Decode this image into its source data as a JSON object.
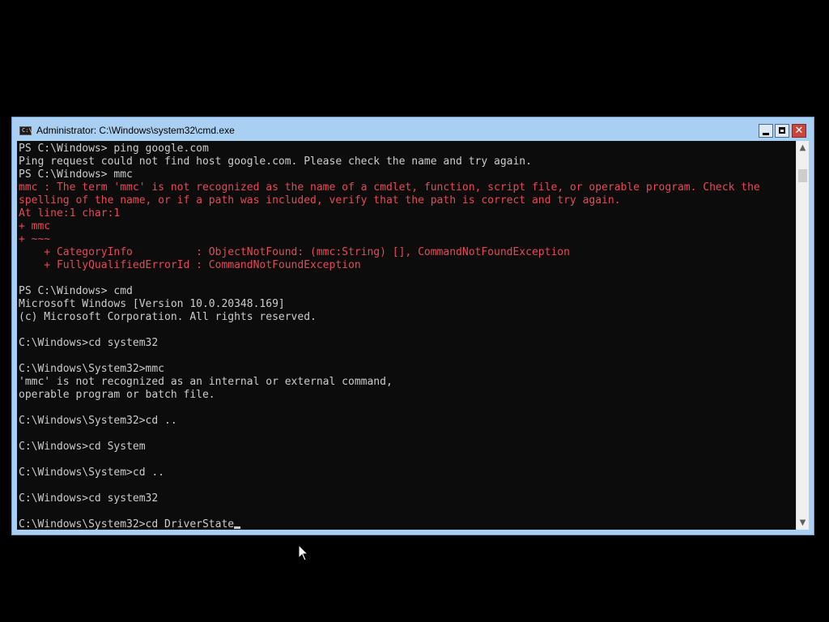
{
  "window": {
    "title": "Administrator: C:\\Windows\\system32\\cmd.exe",
    "icon": "cmd-icon",
    "icon_text": "C:\\",
    "controls": {
      "minimize": "minimize-icon",
      "maximize": "maximize-icon",
      "close": "close-icon",
      "close_glyph": "✕"
    }
  },
  "colors": {
    "console_bg": "#0c0c0c",
    "text": "#cccccc",
    "error_text": "#e74856",
    "titlebar": "#a9d0f2",
    "close_button": "#c8473c"
  },
  "console": {
    "lines": [
      {
        "text": "PS C:\\Windows> ping google.com",
        "style": "normal"
      },
      {
        "text": "Ping request could not find host google.com. Please check the name and try again.",
        "style": "normal"
      },
      {
        "text": "PS C:\\Windows> mmc",
        "style": "normal"
      },
      {
        "text": "mmc : The term 'mmc' is not recognized as the name of a cmdlet, function, script file, or operable program. Check the",
        "style": "error"
      },
      {
        "text": "spelling of the name, or if a path was included, verify that the path is correct and try again.",
        "style": "error"
      },
      {
        "text": "At line:1 char:1",
        "style": "error"
      },
      {
        "text": "+ mmc",
        "style": "error"
      },
      {
        "text": "+ ~~~",
        "style": "error"
      },
      {
        "text": "    + CategoryInfo          : ObjectNotFound: (mmc:String) [], CommandNotFoundException",
        "style": "error"
      },
      {
        "text": "    + FullyQualifiedErrorId : CommandNotFoundException",
        "style": "error"
      },
      {
        "text": "",
        "style": "normal"
      },
      {
        "text": "PS C:\\Windows> cmd",
        "style": "normal"
      },
      {
        "text": "Microsoft Windows [Version 10.0.20348.169]",
        "style": "normal"
      },
      {
        "text": "(c) Microsoft Corporation. All rights reserved.",
        "style": "normal"
      },
      {
        "text": "",
        "style": "normal"
      },
      {
        "text": "C:\\Windows>cd system32",
        "style": "normal"
      },
      {
        "text": "",
        "style": "normal"
      },
      {
        "text": "C:\\Windows\\System32>mmc",
        "style": "normal"
      },
      {
        "text": "'mmc' is not recognized as an internal or external command,",
        "style": "normal"
      },
      {
        "text": "operable program or batch file.",
        "style": "normal"
      },
      {
        "text": "",
        "style": "normal"
      },
      {
        "text": "C:\\Windows\\System32>cd ..",
        "style": "normal"
      },
      {
        "text": "",
        "style": "normal"
      },
      {
        "text": "C:\\Windows>cd System",
        "style": "normal"
      },
      {
        "text": "",
        "style": "normal"
      },
      {
        "text": "C:\\Windows\\System>cd ..",
        "style": "normal"
      },
      {
        "text": "",
        "style": "normal"
      },
      {
        "text": "C:\\Windows>cd system32",
        "style": "normal"
      },
      {
        "text": "",
        "style": "normal"
      }
    ],
    "prompt_line": "C:\\Windows\\System32>cd DriverState"
  },
  "scrollbar": {
    "up_arrow": "▲",
    "down_arrow": "▼"
  },
  "mouse_pointer": "arrow-pointer-icon"
}
